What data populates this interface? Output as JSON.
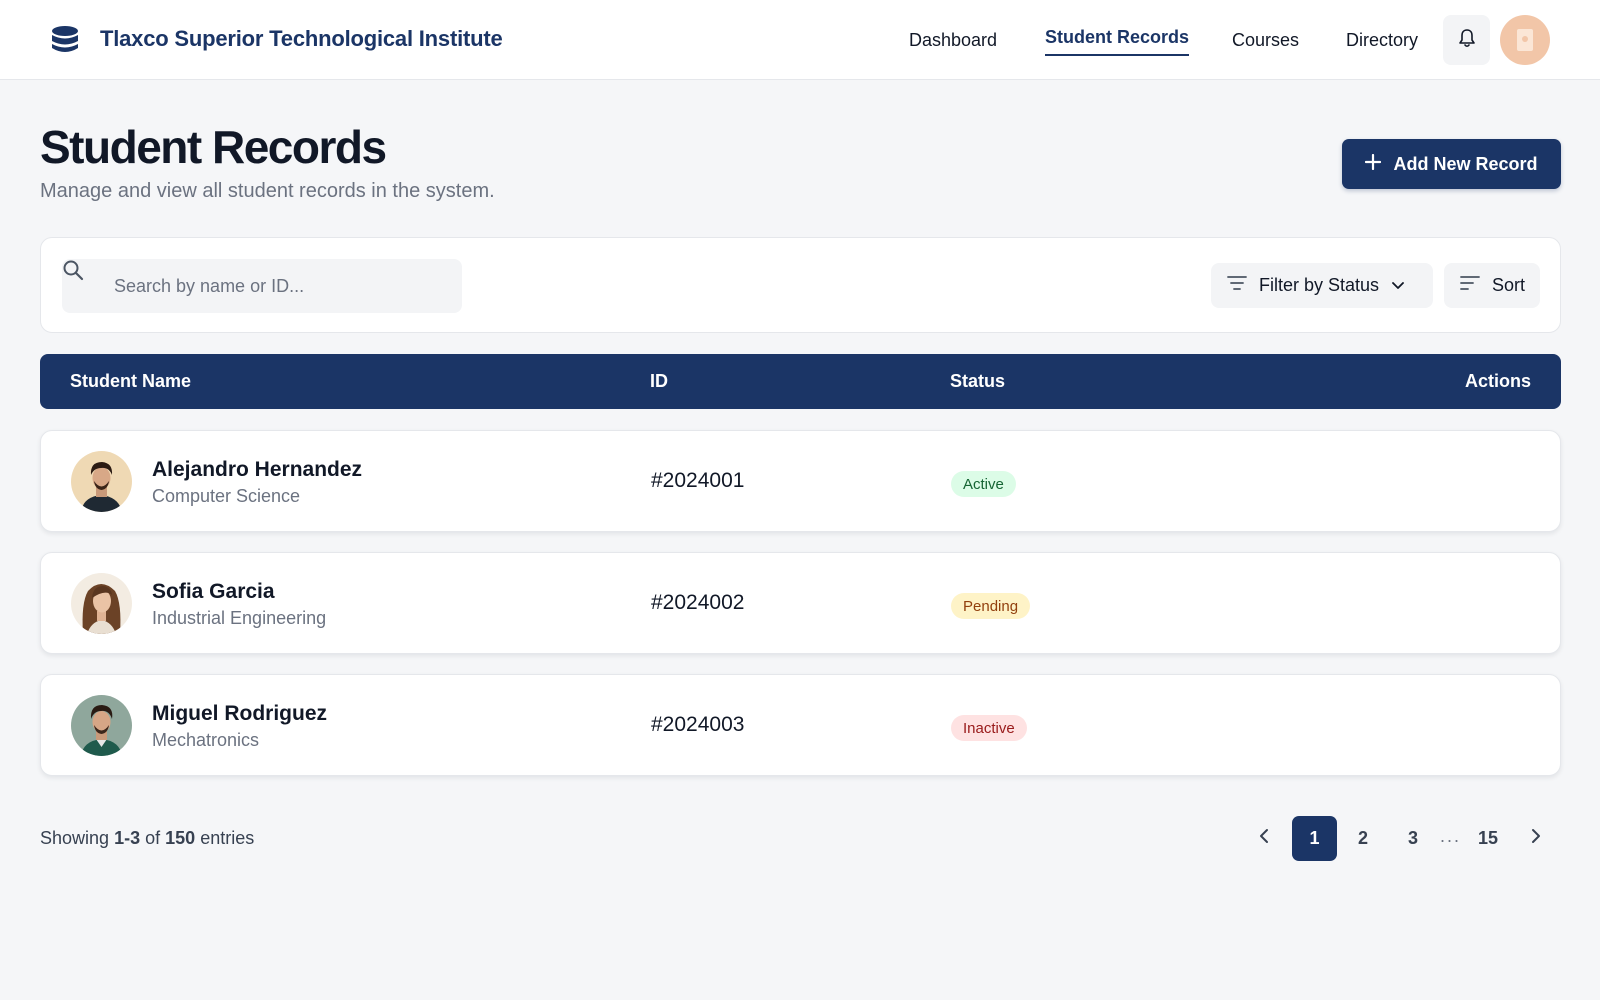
{
  "header": {
    "brand": "Tlaxco Superior Technological Institute",
    "nav": [
      "Dashboard",
      "Student Records",
      "Courses",
      "Directory"
    ],
    "active_nav": "Student Records",
    "icons": {
      "logo": "database-stack-icon",
      "notifications": "bell-icon",
      "user": "user-avatar"
    }
  },
  "page": {
    "title": "Student Records",
    "subtitle": "Manage and view all student records in the system.",
    "add_button": "Add New Record"
  },
  "toolbar": {
    "search_placeholder": "Search by name or ID...",
    "filter_label": "Filter by Status",
    "sort_label": "Sort"
  },
  "table": {
    "columns": [
      "Student Name",
      "ID",
      "Status",
      "Actions"
    ],
    "rows": [
      {
        "name": "Alejandro Hernandez",
        "department": "Computer Science",
        "id": "#2024001",
        "status": "Active"
      },
      {
        "name": "Sofia Garcia",
        "department": "Industrial Engineering",
        "id": "#2024002",
        "status": "Pending"
      },
      {
        "name": "Miguel Rodriguez",
        "department": "Mechatronics",
        "id": "#2024003",
        "status": "Inactive"
      }
    ]
  },
  "pagination": {
    "showing_prefix": "Showing",
    "range": "1-3",
    "of_word": "of",
    "total": "150",
    "entries_word": "entries",
    "pages": [
      "1",
      "2",
      "3"
    ],
    "ellipsis": "...",
    "last_page": "15",
    "current_page": "1"
  },
  "colors": {
    "primary": "#1b3566",
    "status_active_bg": "#dcfce7",
    "status_active_text": "#166534",
    "status_pending_bg": "#fef3c7",
    "status_pending_text": "#92400e",
    "status_inactive_bg": "#fee2e2",
    "status_inactive_text": "#991b1b"
  }
}
